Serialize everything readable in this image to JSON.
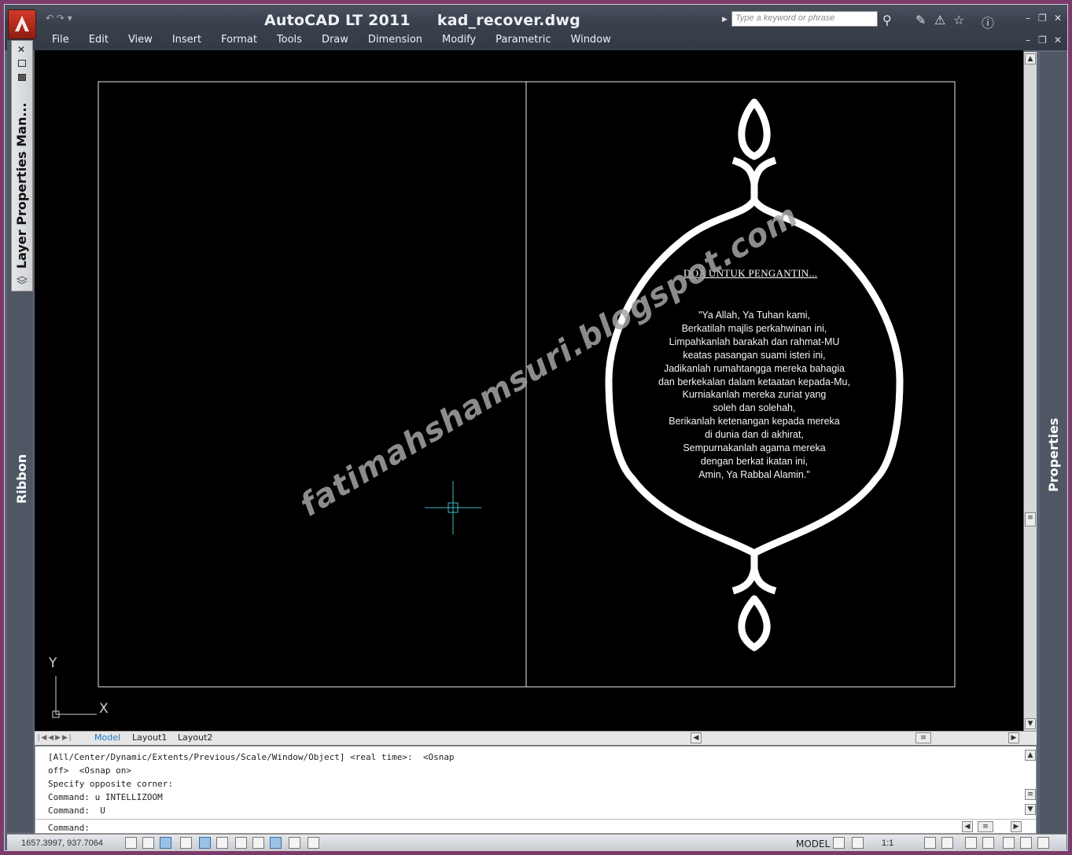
{
  "window": {
    "title": "AutoCAD LT 2011     kad_recover.dwg",
    "search_placeholder": "Type a keyword or phrase",
    "minimize": "–",
    "restore": "❐",
    "close": "✕"
  },
  "quick_access": {
    "undo_redo": "↶ ↷ ▾"
  },
  "menu": [
    "File",
    "Edit",
    "View",
    "Insert",
    "Format",
    "Tools",
    "Draw",
    "Dimension",
    "Modify",
    "Parametric",
    "Window"
  ],
  "palettes": {
    "layer_properties": "Layer Properties Man...",
    "ribbon": "Ribbon",
    "properties": "Properties"
  },
  "drawing": {
    "heading": "DOA UNTUK PENGANTIN...",
    "poem": [
      "\"Ya Allah, Ya Tuhan kami,",
      "Berkatilah majlis perkahwinan ini,",
      "Limpahkanlah barakah  dan rahmat-MU",
      "keatas pasangan suami isteri ini,",
      "Jadikanlah rumahtangga mereka bahagia",
      "dan berkekalan dalam ketaatan kepada-Mu,",
      "Kurniakanlah mereka zuriat yang",
      "soleh dan solehah,",
      "Berikanlah ketenangan kepada mereka",
      "di dunia dan di akhirat,",
      "Sempurnakanlah agama mereka",
      "dengan berkat ikatan ini,",
      "Amin, Ya Rabbal Alamin.\""
    ],
    "watermark": "fatimahshamsuri.blogspot.com",
    "ucs_x": "X",
    "ucs_y": "Y"
  },
  "tabs": [
    "Model",
    "Layout1",
    "Layout2"
  ],
  "command": {
    "history": [
      "[All/Center/Dynamic/Extents/Previous/Scale/Window/Object] <real time>:  <Osnap",
      "off>  <Osnap on>",
      "Specify opposite corner:",
      "Command: u INTELLIZOOM",
      "Command:  U"
    ],
    "prompt": "Command:"
  },
  "status": {
    "coordinates": "1657.3997, 937.7064",
    "space": "MODEL",
    "annotation_scale": "1:1"
  },
  "colors": {
    "canvas": "#000000",
    "frame": "#7a3a6a",
    "crosshair": "#3fb8c8"
  }
}
